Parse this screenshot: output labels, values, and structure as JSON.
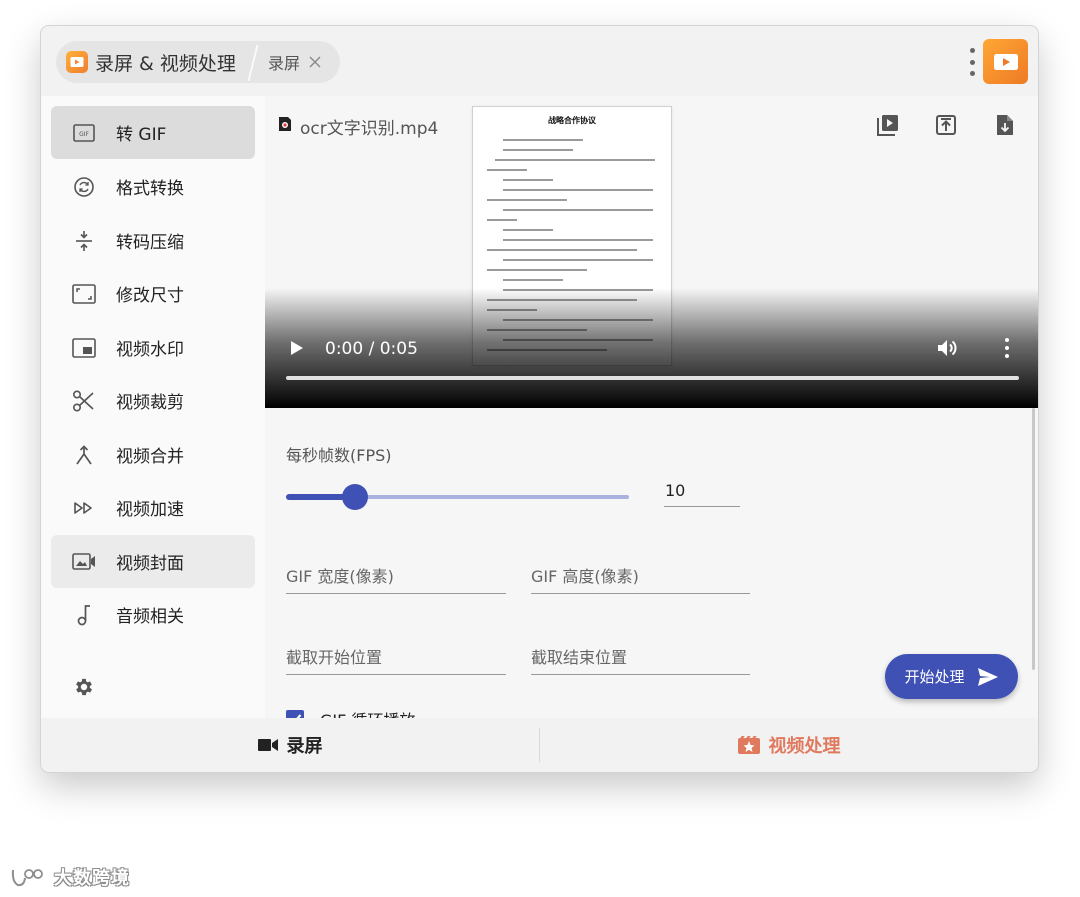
{
  "titlebar": {
    "main_tab_label": "录屏 & 视频处理",
    "sub_tab_label": "录屏"
  },
  "sidebar": {
    "items": [
      {
        "label": "转 GIF",
        "icon": "gif-icon",
        "state": "active"
      },
      {
        "label": "格式转换",
        "icon": "convert-icon",
        "state": "normal"
      },
      {
        "label": "转码压缩",
        "icon": "compress-icon",
        "state": "normal"
      },
      {
        "label": "修改尺寸",
        "icon": "resize-icon",
        "state": "normal"
      },
      {
        "label": "视频水印",
        "icon": "watermark-icon",
        "state": "normal"
      },
      {
        "label": "视频裁剪",
        "icon": "scissors-icon",
        "state": "normal"
      },
      {
        "label": "视频合并",
        "icon": "merge-icon",
        "state": "normal"
      },
      {
        "label": "视频加速",
        "icon": "fast-forward-icon",
        "state": "normal"
      },
      {
        "label": "视频封面",
        "icon": "cover-icon",
        "state": "hover"
      },
      {
        "label": "音频相关",
        "icon": "music-note-icon",
        "state": "normal"
      }
    ],
    "settings_icon": "gear-icon"
  },
  "video": {
    "filename": "ocr文字识别.mp4",
    "time": "0:00 / 0:05",
    "progress": 0,
    "document_title": "战略合作协议"
  },
  "form": {
    "fps_label": "每秒帧数(FPS)",
    "fps_value": "10",
    "fps_slider_fraction": 0.2,
    "width_placeholder": "GIF 宽度(像素)",
    "height_placeholder": "GIF 高度(像素)",
    "start_placeholder": "截取开始位置",
    "end_placeholder": "截取结束位置",
    "loop_label": "GIF 循环播放",
    "loop_checked": true,
    "start_button": "开始处理"
  },
  "bottom_tabs": {
    "record_label": "录屏",
    "video_label": "视频处理"
  },
  "watermark": {
    "text": "大数跨境"
  },
  "colors": {
    "accent": "#3f51b5",
    "brand_orange": "#f08a2e",
    "video_tab": "#e07a5f",
    "active_item": "#dcdcdc"
  }
}
